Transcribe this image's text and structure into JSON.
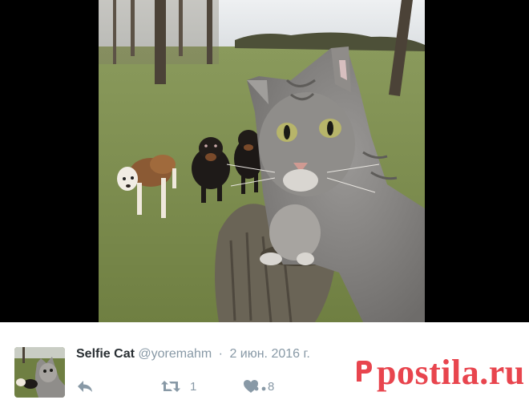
{
  "tweet": {
    "display_name": "Selfie Cat",
    "handle": "@yoremahm",
    "separator": "·",
    "date": "2 июн. 2016 г."
  },
  "actions": {
    "reply_icon": "reply-arrow-icon",
    "retweet_icon": "retweet-icon",
    "retweet_count": "1",
    "like_icon": "heart-icon",
    "like_count": "8",
    "more_icon": "more-dots-icon"
  },
  "watermark": {
    "text": "postila.ru",
    "color": "#e8454e"
  },
  "colors": {
    "meta_gray": "#8899a6",
    "name_dark": "#292f33"
  }
}
